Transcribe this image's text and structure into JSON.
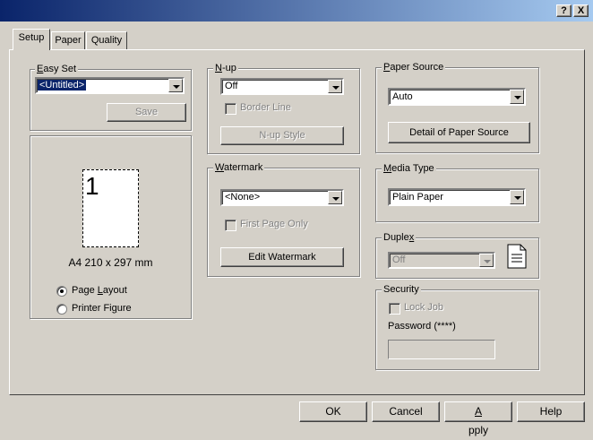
{
  "window": {
    "help_btn": "?",
    "close_btn": "X"
  },
  "tabs": [
    {
      "label": "Setup"
    },
    {
      "label": "Paper"
    },
    {
      "label": "Quality"
    }
  ],
  "easy_set": {
    "label": "Easy Set",
    "value": "<Untitled>",
    "save_label": "Save"
  },
  "preview": {
    "page_number": "1",
    "paper_size": "A4 210 x 297 mm",
    "radio_page_layout": "Page Layout",
    "radio_printer_figure": "Printer Figure"
  },
  "nup": {
    "label": "N-up",
    "value": "Off",
    "border_line": "Border Line",
    "style_button": "N-up Style"
  },
  "watermark": {
    "label": "Watermark",
    "value": "<None>",
    "first_page_only": "First Page Only",
    "edit_button": "Edit Watermark"
  },
  "paper_source": {
    "label": "Paper Source",
    "value": "Auto",
    "detail_button": "Detail of Paper Source"
  },
  "media_type": {
    "label": "Media Type",
    "value": "Plain Paper"
  },
  "duplex": {
    "label": "Duplex",
    "value": "Off"
  },
  "security": {
    "label": "Security",
    "lock_job": "Lock Job",
    "password_label": "Password (****)"
  },
  "footer": {
    "ok": "OK",
    "cancel": "Cancel",
    "apply": "Apply",
    "help": "Help"
  }
}
